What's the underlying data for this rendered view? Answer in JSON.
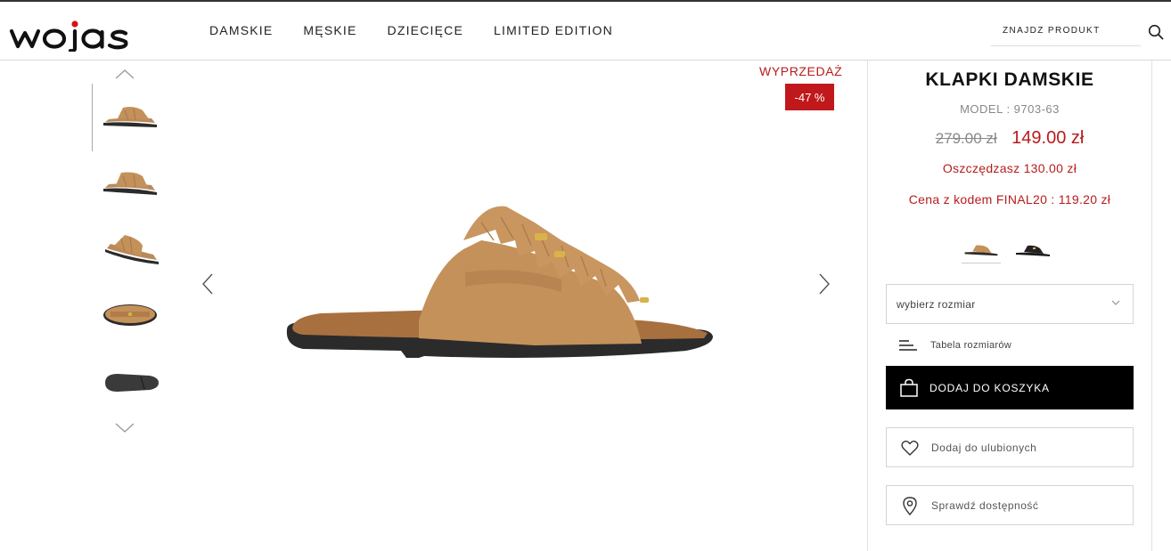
{
  "brand": {
    "logo_text": "wojas"
  },
  "nav": {
    "items": [
      {
        "label": "DAMSKIE"
      },
      {
        "label": "MĘSKIE"
      },
      {
        "label": "DZIECIĘCE"
      },
      {
        "label": "LIMITED EDITION"
      }
    ]
  },
  "search": {
    "placeholder": "ZNAJDŹ PRODUKT"
  },
  "gallery": {
    "thumbnail_count": 5,
    "sale_label": "WYPRZEDAŻ",
    "discount_badge": "-47 %"
  },
  "product": {
    "title": "KLAPKI DAMSKIE",
    "model": "MODEL : 9703-63",
    "old_price": "279.00 zł",
    "new_price": "149.00 zł",
    "savings": "Oszczędzasz 130.00 zł",
    "code_price": "Cena z kodem FINAL20 : 119.20 zł",
    "color_variants": [
      "camel",
      "black"
    ]
  },
  "size_select": {
    "placeholder": "wybierz rozmiar"
  },
  "size_table": {
    "label": "Tabela rozmiarów"
  },
  "actions": {
    "add_to_cart": "DODAJ DO KOSZYKA",
    "add_to_favorites": "Dodaj do ulubionych",
    "check_availability": "Sprawdź dostępność"
  },
  "colors": {
    "accent_red": "#b71c1c",
    "badge_red": "#c0181b",
    "logo_red": "#d6121a",
    "leather": "#c4915a",
    "sole": "#2b2b2b"
  }
}
